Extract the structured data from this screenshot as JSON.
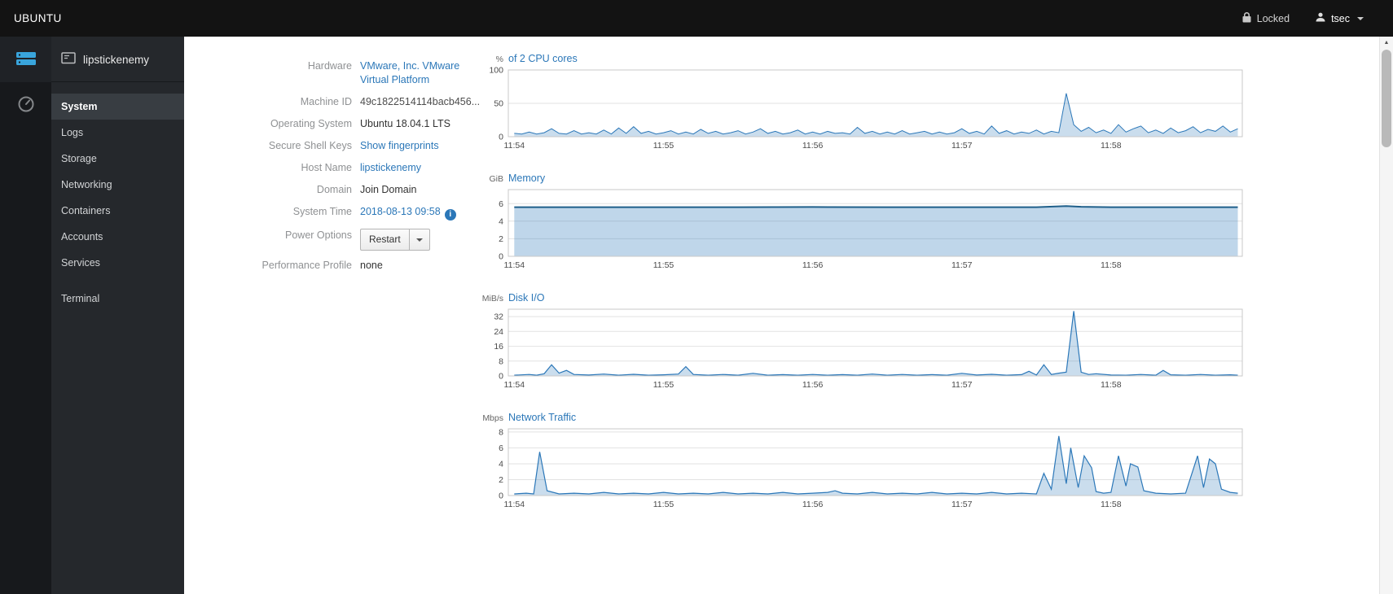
{
  "topbar": {
    "brand": "UBUNTU",
    "locked": "Locked",
    "user": "tsec"
  },
  "sidebar": {
    "host": "lipstickenemy",
    "items": [
      {
        "label": "System"
      },
      {
        "label": "Logs"
      },
      {
        "label": "Storage"
      },
      {
        "label": "Networking"
      },
      {
        "label": "Containers"
      },
      {
        "label": "Accounts"
      },
      {
        "label": "Services"
      },
      {
        "label": "Terminal"
      }
    ]
  },
  "system": {
    "rows": [
      {
        "label": "Hardware",
        "value": "VMware, Inc. VMware Virtual Platform"
      },
      {
        "label": "Machine ID",
        "value": "49c1822514114bacb456..."
      },
      {
        "label": "Operating System",
        "value": "Ubuntu 18.04.1 LTS"
      },
      {
        "label": "Secure Shell Keys",
        "value": "Show fingerprints"
      },
      {
        "label": "Host Name",
        "value": "lipstickenemy"
      },
      {
        "label": "Domain",
        "value": "Join Domain"
      },
      {
        "label": "System Time",
        "value": "2018-08-13 09:58"
      },
      {
        "label": "Power Options",
        "value": "Restart"
      },
      {
        "label": "Performance Profile",
        "value": "none"
      }
    ]
  },
  "colors": {
    "link": "#2b77b8",
    "chart_line": "#2b77b8",
    "chart_fill": "rgba(43,119,184,0.25)"
  },
  "chart_data": [
    {
      "type": "area",
      "unit": "%",
      "title": "of 2 CPU cores",
      "xlim": [
        -0.04,
        4.88
      ],
      "ylim": [
        0,
        100
      ],
      "yticks": [
        0,
        50,
        100
      ],
      "xticks": [
        {
          "v": 0,
          "label": "11:54"
        },
        {
          "v": 1,
          "label": "11:55"
        },
        {
          "v": 2,
          "label": "11:56"
        },
        {
          "v": 3,
          "label": "11:57"
        },
        {
          "v": 4,
          "label": "11:58"
        }
      ],
      "stroke": "#2b77b8",
      "fill": "rgba(43,119,184,0.25)",
      "stroke_width": 1,
      "points": [
        [
          0,
          5
        ],
        [
          0.05,
          4
        ],
        [
          0.1,
          7
        ],
        [
          0.15,
          4
        ],
        [
          0.2,
          6
        ],
        [
          0.25,
          12
        ],
        [
          0.3,
          5
        ],
        [
          0.35,
          4
        ],
        [
          0.4,
          9
        ],
        [
          0.45,
          4
        ],
        [
          0.5,
          6
        ],
        [
          0.55,
          4
        ],
        [
          0.6,
          10
        ],
        [
          0.65,
          4
        ],
        [
          0.7,
          13
        ],
        [
          0.75,
          5
        ],
        [
          0.8,
          15
        ],
        [
          0.85,
          5
        ],
        [
          0.9,
          8
        ],
        [
          0.95,
          4
        ],
        [
          1,
          6
        ],
        [
          1.05,
          9
        ],
        [
          1.1,
          4
        ],
        [
          1.15,
          7
        ],
        [
          1.2,
          4
        ],
        [
          1.25,
          11
        ],
        [
          1.3,
          5
        ],
        [
          1.35,
          8
        ],
        [
          1.4,
          4
        ],
        [
          1.45,
          6
        ],
        [
          1.5,
          9
        ],
        [
          1.55,
          4
        ],
        [
          1.6,
          7
        ],
        [
          1.65,
          12
        ],
        [
          1.7,
          5
        ],
        [
          1.75,
          8
        ],
        [
          1.8,
          4
        ],
        [
          1.85,
          6
        ],
        [
          1.9,
          10
        ],
        [
          1.95,
          4
        ],
        [
          2,
          7
        ],
        [
          2.05,
          4
        ],
        [
          2.1,
          8
        ],
        [
          2.15,
          5
        ],
        [
          2.2,
          6
        ],
        [
          2.25,
          4
        ],
        [
          2.3,
          14
        ],
        [
          2.35,
          5
        ],
        [
          2.4,
          8
        ],
        [
          2.45,
          4
        ],
        [
          2.5,
          7
        ],
        [
          2.55,
          4
        ],
        [
          2.6,
          9
        ],
        [
          2.65,
          4
        ],
        [
          2.7,
          6
        ],
        [
          2.75,
          8
        ],
        [
          2.8,
          4
        ],
        [
          2.85,
          7
        ],
        [
          2.9,
          4
        ],
        [
          2.95,
          6
        ],
        [
          3,
          12
        ],
        [
          3.05,
          5
        ],
        [
          3.1,
          8
        ],
        [
          3.15,
          4
        ],
        [
          3.2,
          16
        ],
        [
          3.25,
          5
        ],
        [
          3.3,
          9
        ],
        [
          3.35,
          4
        ],
        [
          3.4,
          7
        ],
        [
          3.45,
          5
        ],
        [
          3.5,
          10
        ],
        [
          3.55,
          4
        ],
        [
          3.6,
          8
        ],
        [
          3.65,
          6
        ],
        [
          3.7,
          65
        ],
        [
          3.75,
          18
        ],
        [
          3.8,
          8
        ],
        [
          3.85,
          14
        ],
        [
          3.9,
          6
        ],
        [
          3.95,
          10
        ],
        [
          4,
          5
        ],
        [
          4.05,
          18
        ],
        [
          4.1,
          7
        ],
        [
          4.15,
          12
        ],
        [
          4.2,
          16
        ],
        [
          4.25,
          6
        ],
        [
          4.3,
          10
        ],
        [
          4.35,
          5
        ],
        [
          4.4,
          13
        ],
        [
          4.45,
          6
        ],
        [
          4.5,
          9
        ],
        [
          4.55,
          15
        ],
        [
          4.6,
          6
        ],
        [
          4.65,
          11
        ],
        [
          4.7,
          8
        ],
        [
          4.75,
          16
        ],
        [
          4.8,
          7
        ],
        [
          4.85,
          12
        ]
      ]
    },
    {
      "type": "area",
      "unit": "GiB",
      "title": "Memory",
      "xlim": [
        -0.04,
        4.88
      ],
      "ylim": [
        0,
        7.6
      ],
      "yticks": [
        0,
        2,
        4,
        6
      ],
      "xticks": [
        {
          "v": 0,
          "label": "11:54"
        },
        {
          "v": 1,
          "label": "11:55"
        },
        {
          "v": 2,
          "label": "11:56"
        },
        {
          "v": 3,
          "label": "11:57"
        },
        {
          "v": 4,
          "label": "11:58"
        }
      ],
      "stroke": "#1f5f8a",
      "fill": "rgba(43,119,184,0.3)",
      "stroke_width": 2,
      "points": [
        [
          0,
          5.6
        ],
        [
          0.5,
          5.6
        ],
        [
          1,
          5.6
        ],
        [
          1.5,
          5.6
        ],
        [
          2,
          5.62
        ],
        [
          2.5,
          5.6
        ],
        [
          3,
          5.6
        ],
        [
          3.5,
          5.6
        ],
        [
          3.7,
          5.72
        ],
        [
          3.8,
          5.64
        ],
        [
          4,
          5.6
        ],
        [
          4.4,
          5.6
        ],
        [
          4.85,
          5.6
        ]
      ]
    },
    {
      "type": "area",
      "unit": "MiB/s",
      "title": "Disk I/O",
      "xlim": [
        -0.04,
        4.88
      ],
      "ylim": [
        0,
        36
      ],
      "yticks": [
        0,
        8,
        16,
        24,
        32
      ],
      "xticks": [
        {
          "v": 0,
          "label": "11:54"
        },
        {
          "v": 1,
          "label": "11:55"
        },
        {
          "v": 2,
          "label": "11:56"
        },
        {
          "v": 3,
          "label": "11:57"
        },
        {
          "v": 4,
          "label": "11:58"
        }
      ],
      "stroke": "#2b77b8",
      "fill": "rgba(43,119,184,0.25)",
      "stroke_width": 1.2,
      "points": [
        [
          0,
          0.4
        ],
        [
          0.1,
          0.8
        ],
        [
          0.15,
          0.4
        ],
        [
          0.2,
          1.2
        ],
        [
          0.25,
          6
        ],
        [
          0.3,
          1.5
        ],
        [
          0.35,
          3
        ],
        [
          0.4,
          0.8
        ],
        [
          0.5,
          0.5
        ],
        [
          0.6,
          1
        ],
        [
          0.7,
          0.4
        ],
        [
          0.8,
          0.9
        ],
        [
          0.9,
          0.4
        ],
        [
          1,
          0.6
        ],
        [
          1.1,
          1
        ],
        [
          1.15,
          5
        ],
        [
          1.2,
          0.8
        ],
        [
          1.3,
          0.4
        ],
        [
          1.4,
          0.8
        ],
        [
          1.5,
          0.4
        ],
        [
          1.6,
          1.4
        ],
        [
          1.7,
          0.4
        ],
        [
          1.8,
          0.7
        ],
        [
          1.9,
          0.4
        ],
        [
          2,
          0.8
        ],
        [
          2.1,
          0.4
        ],
        [
          2.2,
          0.7
        ],
        [
          2.3,
          0.4
        ],
        [
          2.4,
          1
        ],
        [
          2.5,
          0.4
        ],
        [
          2.6,
          0.8
        ],
        [
          2.7,
          0.4
        ],
        [
          2.8,
          0.7
        ],
        [
          2.9,
          0.4
        ],
        [
          3,
          1.4
        ],
        [
          3.1,
          0.5
        ],
        [
          3.2,
          0.9
        ],
        [
          3.3,
          0.4
        ],
        [
          3.4,
          0.7
        ],
        [
          3.45,
          2.5
        ],
        [
          3.5,
          0.5
        ],
        [
          3.55,
          6
        ],
        [
          3.6,
          0.8
        ],
        [
          3.65,
          1.5
        ],
        [
          3.7,
          2
        ],
        [
          3.75,
          35
        ],
        [
          3.8,
          2
        ],
        [
          3.85,
          0.8
        ],
        [
          3.9,
          1.2
        ],
        [
          4,
          0.5
        ],
        [
          4.1,
          0.4
        ],
        [
          4.2,
          0.8
        ],
        [
          4.3,
          0.4
        ],
        [
          4.35,
          3
        ],
        [
          4.4,
          0.6
        ],
        [
          4.5,
          0.4
        ],
        [
          4.6,
          0.8
        ],
        [
          4.7,
          0.4
        ],
        [
          4.8,
          0.6
        ],
        [
          4.85,
          0.4
        ]
      ]
    },
    {
      "type": "area",
      "unit": "Mbps",
      "title": "Network Traffic",
      "xlim": [
        -0.04,
        4.88
      ],
      "ylim": [
        0,
        8.4
      ],
      "yticks": [
        0,
        2,
        4,
        6,
        8
      ],
      "xticks": [
        {
          "v": 0,
          "label": "11:54"
        },
        {
          "v": 1,
          "label": "11:55"
        },
        {
          "v": 2,
          "label": "11:56"
        },
        {
          "v": 3,
          "label": "11:57"
        },
        {
          "v": 4,
          "label": "11:58"
        }
      ],
      "stroke": "#2b77b8",
      "fill": "rgba(43,119,184,0.25)",
      "stroke_width": 1.2,
      "points": [
        [
          0,
          0.2
        ],
        [
          0.08,
          0.3
        ],
        [
          0.13,
          0.2
        ],
        [
          0.17,
          5.5
        ],
        [
          0.22,
          0.6
        ],
        [
          0.3,
          0.2
        ],
        [
          0.4,
          0.3
        ],
        [
          0.5,
          0.2
        ],
        [
          0.6,
          0.4
        ],
        [
          0.7,
          0.2
        ],
        [
          0.8,
          0.3
        ],
        [
          0.9,
          0.2
        ],
        [
          1,
          0.4
        ],
        [
          1.1,
          0.2
        ],
        [
          1.2,
          0.3
        ],
        [
          1.3,
          0.2
        ],
        [
          1.4,
          0.4
        ],
        [
          1.5,
          0.2
        ],
        [
          1.6,
          0.3
        ],
        [
          1.7,
          0.2
        ],
        [
          1.8,
          0.4
        ],
        [
          1.9,
          0.2
        ],
        [
          2,
          0.3
        ],
        [
          2.1,
          0.4
        ],
        [
          2.15,
          0.6
        ],
        [
          2.2,
          0.3
        ],
        [
          2.3,
          0.2
        ],
        [
          2.4,
          0.4
        ],
        [
          2.5,
          0.2
        ],
        [
          2.6,
          0.3
        ],
        [
          2.7,
          0.2
        ],
        [
          2.8,
          0.4
        ],
        [
          2.9,
          0.2
        ],
        [
          3,
          0.3
        ],
        [
          3.1,
          0.2
        ],
        [
          3.2,
          0.4
        ],
        [
          3.3,
          0.2
        ],
        [
          3.4,
          0.3
        ],
        [
          3.5,
          0.2
        ],
        [
          3.55,
          2.8
        ],
        [
          3.6,
          0.8
        ],
        [
          3.65,
          7.5
        ],
        [
          3.7,
          1.5
        ],
        [
          3.73,
          6
        ],
        [
          3.78,
          1
        ],
        [
          3.82,
          5
        ],
        [
          3.87,
          3.5
        ],
        [
          3.9,
          0.5
        ],
        [
          3.95,
          0.3
        ],
        [
          4,
          0.4
        ],
        [
          4.05,
          5
        ],
        [
          4.1,
          1.2
        ],
        [
          4.13,
          4
        ],
        [
          4.18,
          3.6
        ],
        [
          4.22,
          0.6
        ],
        [
          4.3,
          0.3
        ],
        [
          4.4,
          0.2
        ],
        [
          4.5,
          0.3
        ],
        [
          4.58,
          5
        ],
        [
          4.62,
          1
        ],
        [
          4.66,
          4.6
        ],
        [
          4.7,
          4
        ],
        [
          4.74,
          0.8
        ],
        [
          4.8,
          0.4
        ],
        [
          4.85,
          0.3
        ]
      ]
    }
  ]
}
